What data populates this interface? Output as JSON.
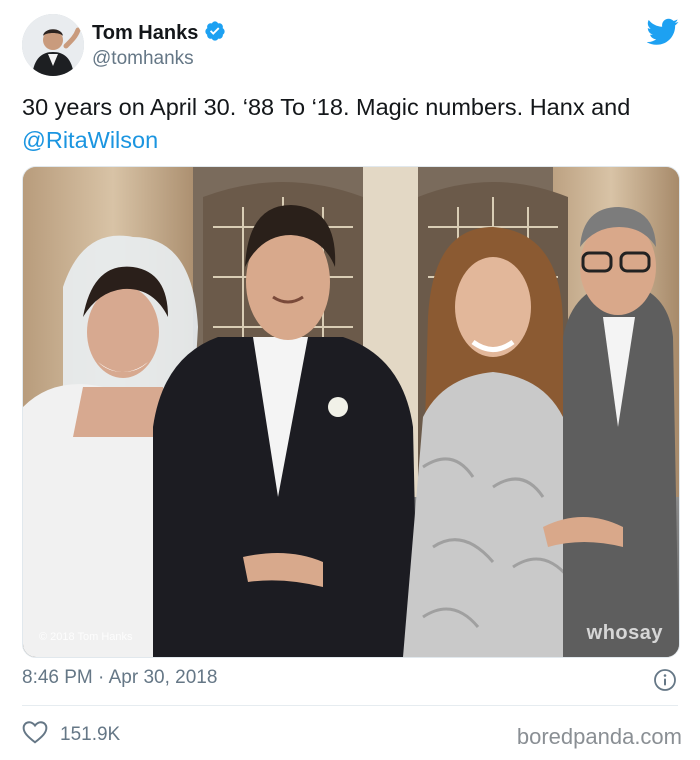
{
  "user": {
    "name": "Tom Hanks",
    "handle": "@tomhanks",
    "verified": true
  },
  "tweet": {
    "text_before": "30 years on April 30. ‘88 To ‘18. Magic numbers. Hanx and ",
    "mention": "@RitaWilson",
    "timestamp": "8:46 PM · Apr 30, 2018"
  },
  "photo": {
    "watermark_left": "© 2018 Tom Hanks",
    "watermark_right": "whosay"
  },
  "engagement": {
    "likes": "151.9K"
  },
  "footer": {
    "source": "boredpanda.com"
  },
  "colors": {
    "twitter_blue": "#1da1f2",
    "mention_blue": "#1b95e0",
    "muted_gray": "#657786"
  },
  "icons": [
    "verified-badge-icon",
    "twitter-bird-icon",
    "info-icon",
    "heart-icon"
  ]
}
